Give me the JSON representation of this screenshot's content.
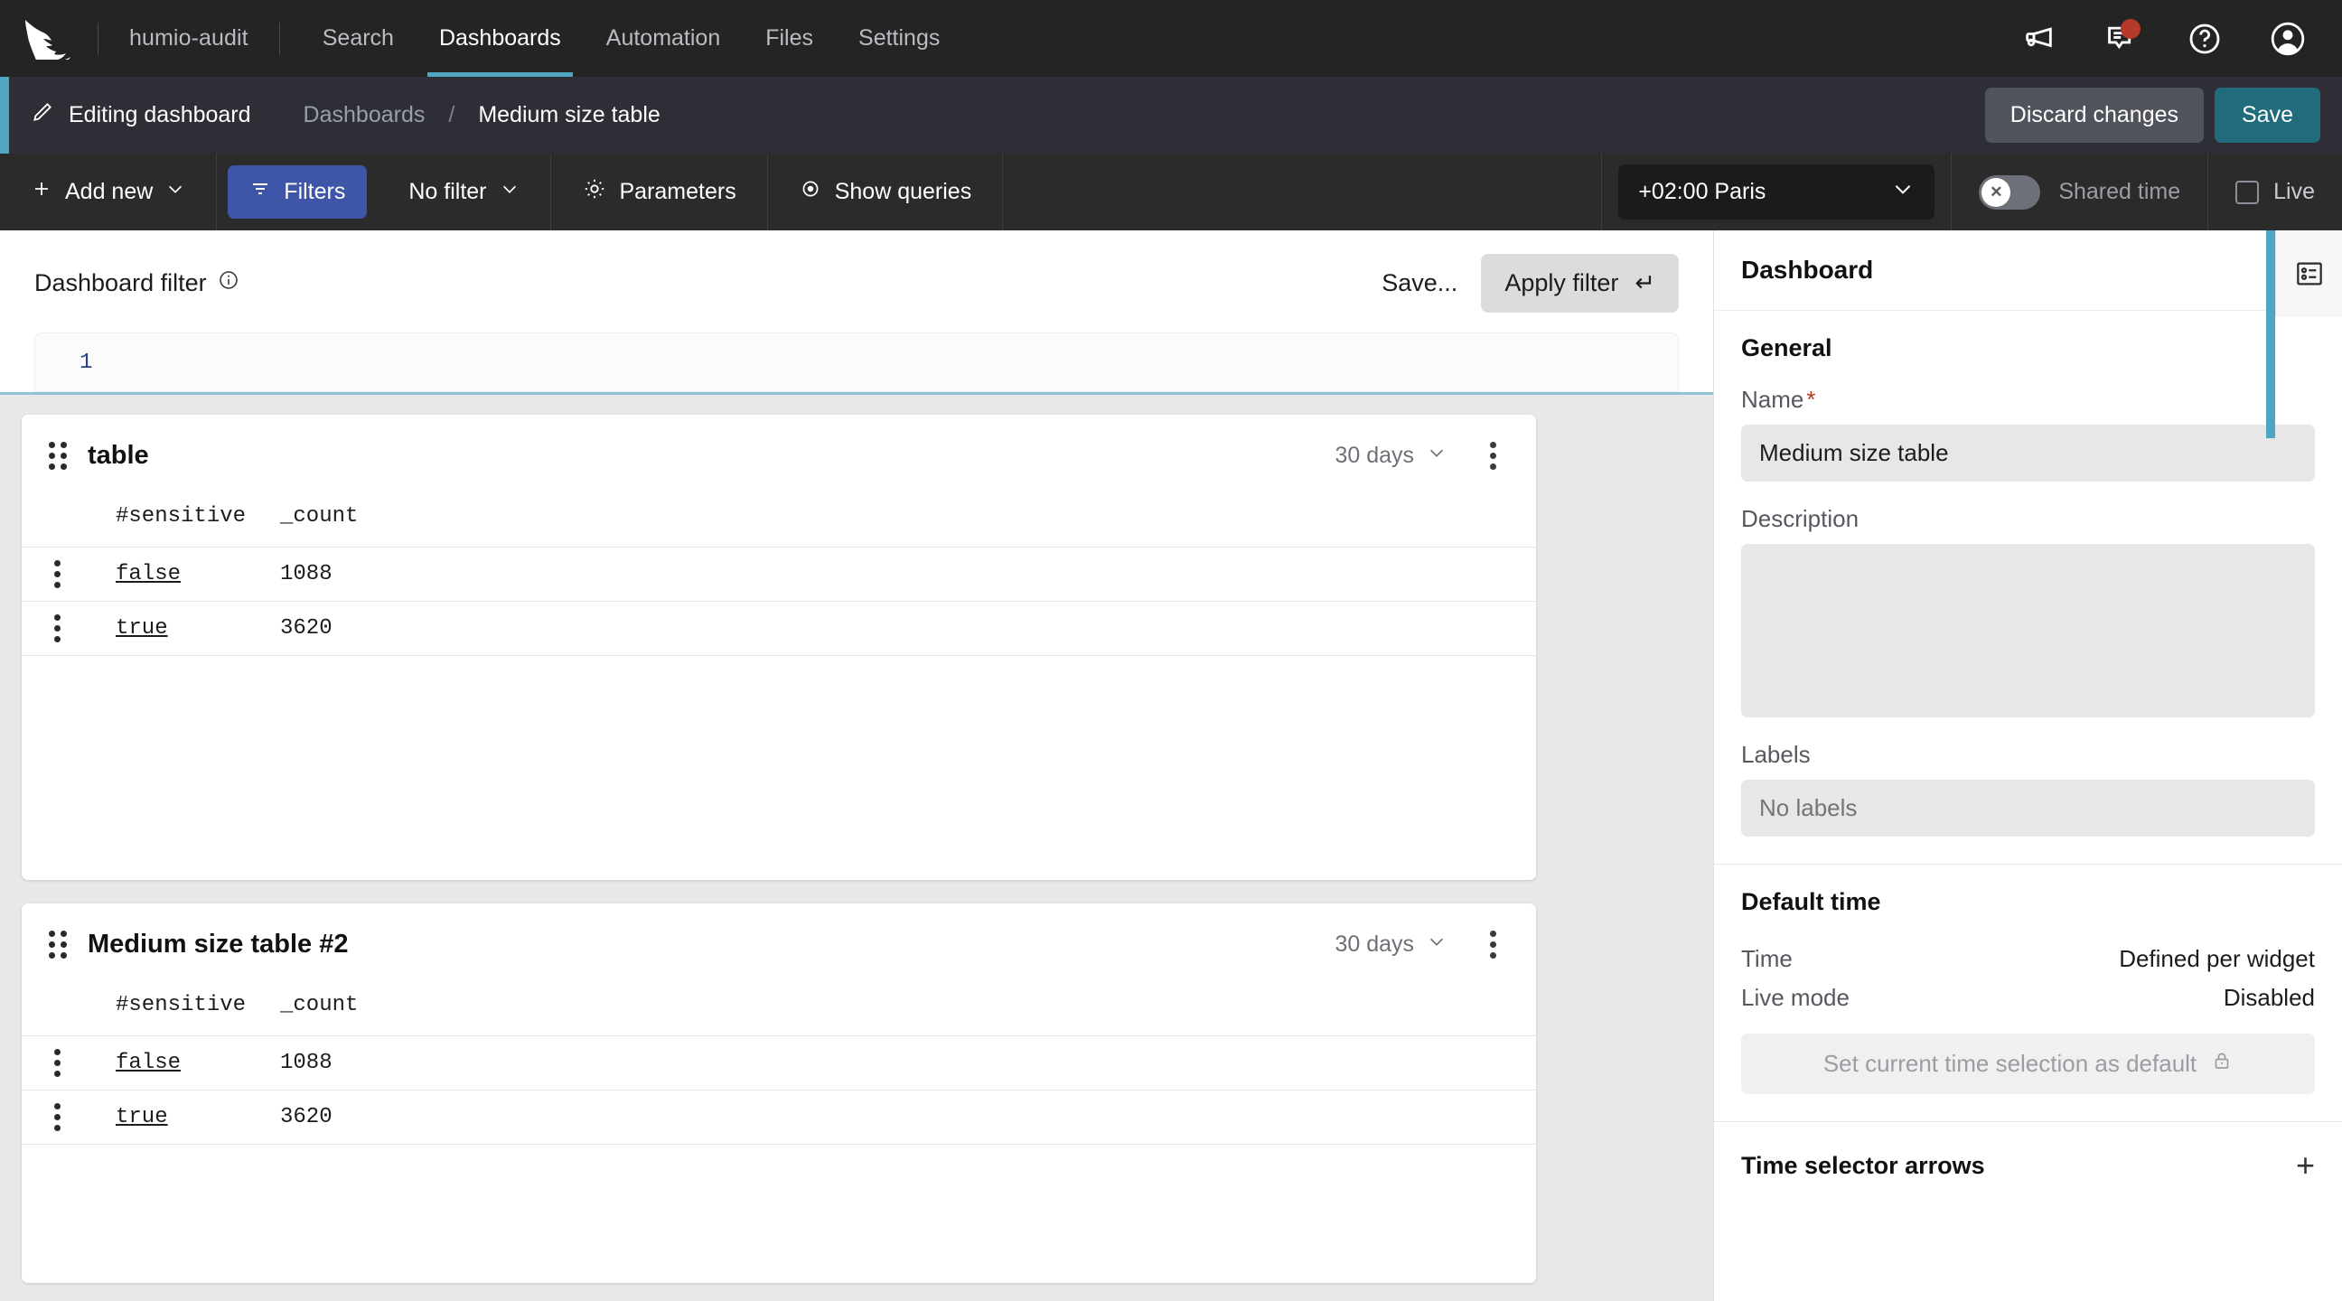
{
  "topnav": {
    "logo": "falcon-logo",
    "org": "humio-audit",
    "items": [
      {
        "label": "Search",
        "active": false
      },
      {
        "label": "Dashboards",
        "active": true
      },
      {
        "label": "Automation",
        "active": false
      },
      {
        "label": "Files",
        "active": false
      },
      {
        "label": "Settings",
        "active": false
      }
    ],
    "icons": [
      {
        "name": "megaphone-icon",
        "badge": false
      },
      {
        "name": "feedback-icon",
        "badge": true
      },
      {
        "name": "help-icon",
        "badge": false
      },
      {
        "name": "user-avatar-icon",
        "badge": false
      }
    ]
  },
  "editbar": {
    "status": "Editing dashboard",
    "breadcrumb_parent": "Dashboards",
    "breadcrumb_sep": "/",
    "breadcrumb_current": "Medium size table",
    "discard_label": "Discard changes",
    "save_label": "Save",
    "accent_color": "#50a6c2",
    "save_color": "#206b7c"
  },
  "toolbar": {
    "add_new": "Add new",
    "filters": "Filters",
    "filter_value": "No filter",
    "parameters": "Parameters",
    "show_queries": "Show queries",
    "timezone": "+02:00 Paris",
    "shared_time": "Shared time",
    "shared_time_state": "off",
    "toggle_glyph": "✕",
    "live": "Live",
    "live_checked": false,
    "filters_color": "#3e55a8"
  },
  "filter_panel": {
    "title": "Dashboard filter",
    "info_icon": "info-icon",
    "save_label": "Save...",
    "apply_label": "Apply filter",
    "apply_glyph": "↵",
    "line_number": "1",
    "query_value": ""
  },
  "widgets": [
    {
      "title": "table",
      "time_range": "30 days",
      "columns": [
        "#sensitive",
        "_count"
      ],
      "rows": [
        {
          "sensitive": "false",
          "count": "1088"
        },
        {
          "sensitive": "true",
          "count": "3620"
        }
      ]
    },
    {
      "title": "Medium size table #2",
      "time_range": "30 days",
      "columns": [
        "#sensitive",
        "_count"
      ],
      "rows": [
        {
          "sensitive": "false",
          "count": "1088"
        },
        {
          "sensitive": "true",
          "count": "3620"
        }
      ]
    }
  ],
  "sidebar": {
    "header": "Dashboard",
    "general": {
      "title": "General",
      "name_label": "Name",
      "name_required": "*",
      "name_value": "Medium size table",
      "description_label": "Description",
      "description_value": "",
      "labels_label": "Labels",
      "labels_placeholder": "No labels"
    },
    "default_time": {
      "title": "Default time",
      "time_key": "Time",
      "time_value": "Defined per widget",
      "live_key": "Live mode",
      "live_value": "Disabled",
      "set_default_label": "Set current time selection as default",
      "lock_icon": "lock-icon"
    },
    "time_selector_arrows": {
      "title": "Time selector arrows",
      "add_glyph": "+"
    },
    "panel_toggle_icon": "list-panel-icon"
  }
}
